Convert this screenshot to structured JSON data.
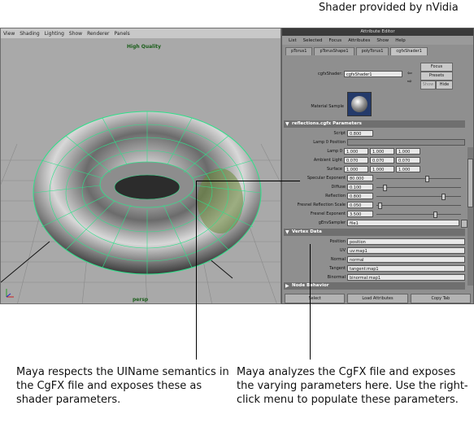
{
  "caption_top": "Shader provided by nVidia",
  "viewport": {
    "menus": [
      "View",
      "Shading",
      "Lighting",
      "Show",
      "Renderer",
      "Panels"
    ],
    "quality_label": "High Quality",
    "camera_label": "persp"
  },
  "ae": {
    "window_title": "Attribute Editor",
    "menus": [
      "List",
      "Selected",
      "Focus",
      "Attributes",
      "Show",
      "Help"
    ],
    "tabs": [
      "pTorus1",
      "pTorusShape1",
      "polyTorus1",
      "cgfxShader1"
    ],
    "shader_label": "cgfxShader:",
    "shader_value": "cgfxShader1",
    "focus_btn": "Focus",
    "presets_btn": "Presets",
    "show_btn": "Show",
    "hide_btn": "Hide",
    "material_sample_label": "Material Sample",
    "section1": "reflections.cgfx Parameters",
    "params": {
      "script_label": "Script",
      "script_value": "0.800",
      "lamp0pos_label": "Lamp 0 Position",
      "lamp0_label": "Lamp 0",
      "lamp0_v": [
        "1.000",
        "1.000",
        "1.000"
      ],
      "ambient_label": "Ambient Light",
      "ambient_v": [
        "0.070",
        "0.070",
        "0.070"
      ],
      "surface_label": "Surface",
      "surface_v": [
        "1.000",
        "1.000",
        "1.000"
      ],
      "spec_label": "Specular Exponent",
      "spec_value": "80.000",
      "diffuse_label": "Diffuse",
      "diffuse_value": "0.100",
      "reflection_label": "Reflection",
      "reflection_value": "0.800",
      "fresnel_scale_label": "Fresnel Reflection Scale",
      "fresnel_scale_value": "0.050",
      "fresnel_exp_label": "Fresnel Exponent",
      "fresnel_exp_value": "3.500",
      "genv_label": "gEnvSampler",
      "genv_value": "file1"
    },
    "section2": "Vertex Data",
    "vertex": {
      "position_label": "Position",
      "position_value": "position",
      "uv_label": "UV",
      "uv_value": "uv:map1",
      "normal_label": "Normal",
      "normal_value": "normal",
      "tangent_label": "Tangent",
      "tangent_value": "tangent:map1",
      "binormal_label": "Binormal",
      "binormal_value": "binormal:map1"
    },
    "section3": "Node Behavior",
    "bottom_buttons": [
      "Select",
      "Load Attributes",
      "Copy Tab"
    ]
  },
  "note_left": "Maya respects the UIName semantics in the CgFX file and exposes these as shader parameters.",
  "note_right": "Maya analyzes the CgFX file and exposes the varying parameters here. Use the right-click menu to populate these parameters."
}
